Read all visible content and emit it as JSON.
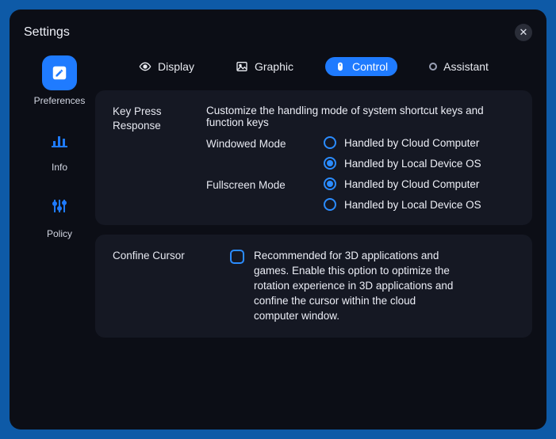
{
  "window": {
    "title": "Settings"
  },
  "sidebar": {
    "items": [
      {
        "label": "Preferences"
      },
      {
        "label": "Info"
      },
      {
        "label": "Policy"
      }
    ]
  },
  "tabs": {
    "display": "Display",
    "graphic": "Graphic",
    "control": "Control",
    "assistant": "Assistant",
    "active": "control"
  },
  "control": {
    "keypress": {
      "title": "Key Press Response",
      "description": "Customize the handling mode of system shortcut keys and function keys",
      "windowed": {
        "label": "Windowed Mode",
        "opt_cloud": "Handled by Cloud Computer",
        "opt_local": "Handled by Local Device OS",
        "selected": "local"
      },
      "fullscreen": {
        "label": "Fullscreen Mode",
        "opt_cloud": "Handled by Cloud Computer",
        "opt_local": "Handled by Local Device OS",
        "selected": "cloud"
      }
    },
    "confine": {
      "title": "Confine Cursor",
      "checked": false,
      "description": "Recommended for 3D applications and games. Enable this option to optimize the rotation experience in 3D applications and confine the cursor within the cloud computer window."
    }
  }
}
